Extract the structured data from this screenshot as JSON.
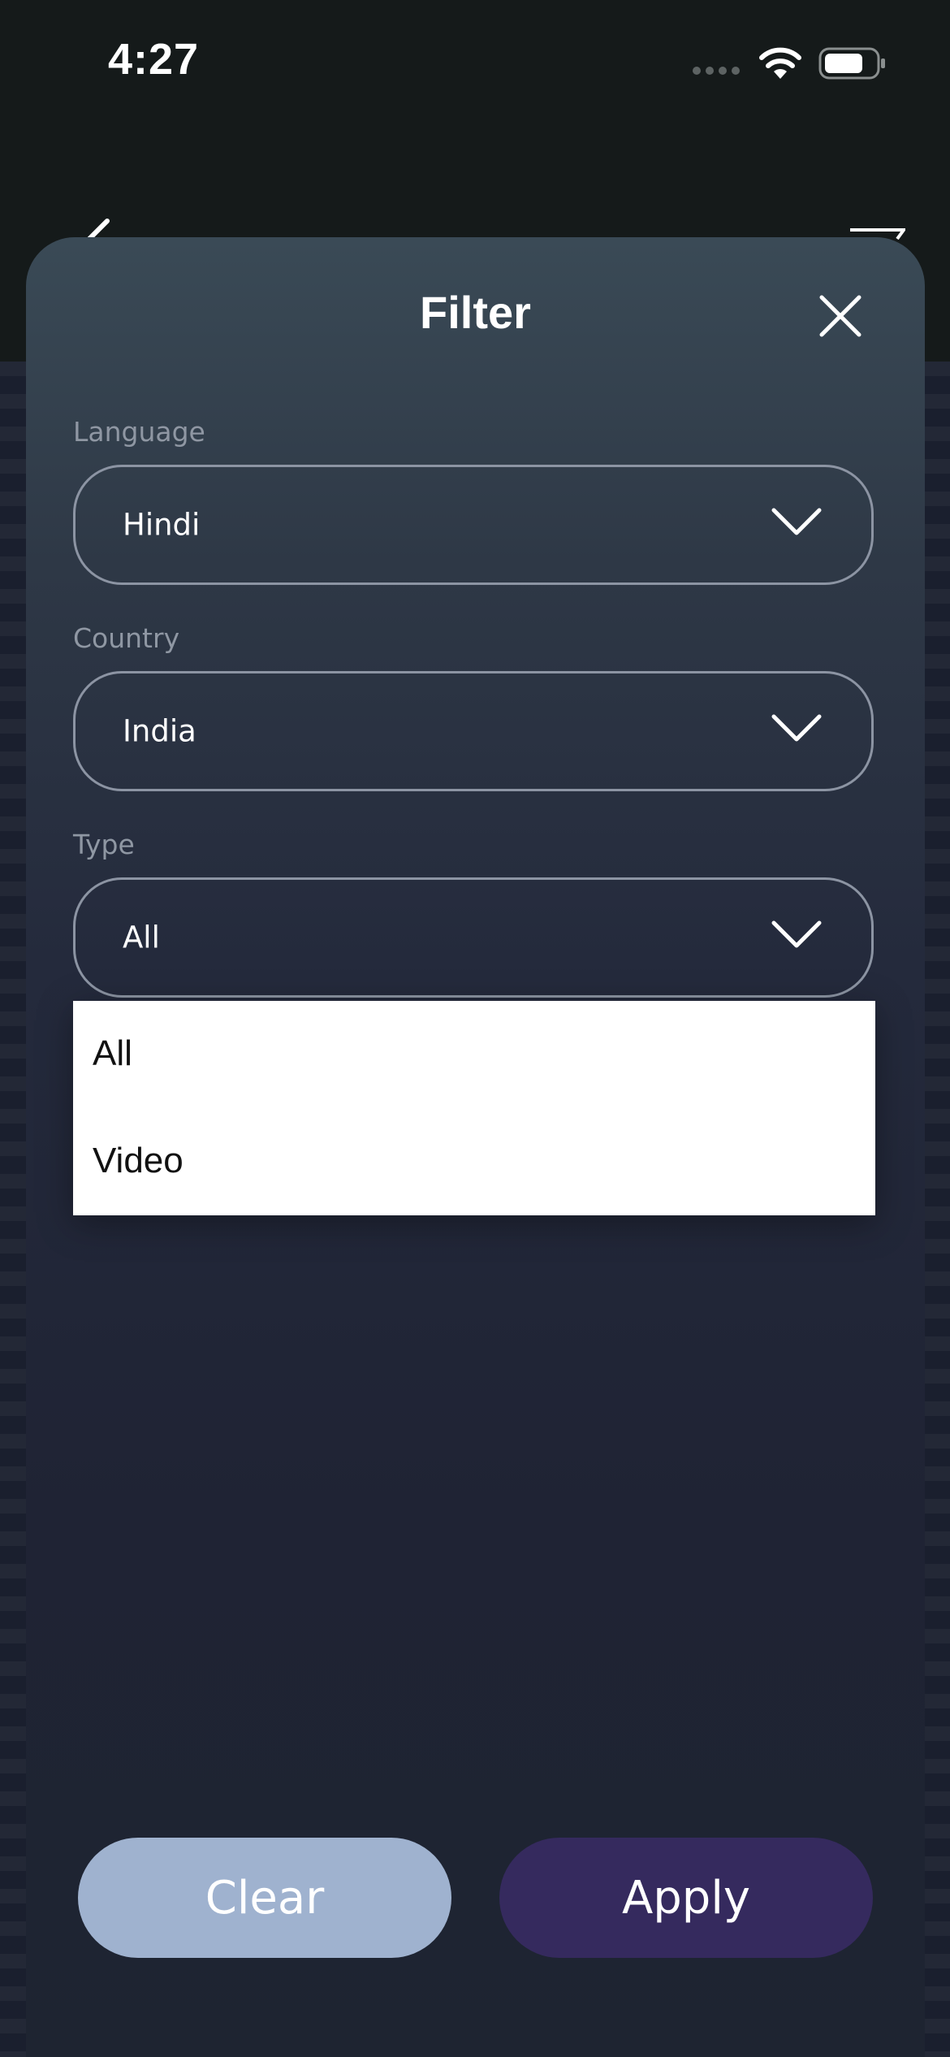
{
  "status_bar": {
    "time": "4:27"
  },
  "sheet": {
    "title": "Filter",
    "close_icon": "close-icon"
  },
  "filters": {
    "language": {
      "label": "Language",
      "value": "Hindi"
    },
    "country": {
      "label": "Country",
      "value": "India"
    },
    "type": {
      "label": "Type",
      "value": "All"
    }
  },
  "type_dropdown": {
    "options": [
      "All",
      "Video"
    ]
  },
  "buttons": {
    "clear_label": "Clear",
    "apply_label": "Apply"
  },
  "colors": {
    "clear_button": "#9fb2cf",
    "apply_button": "#352a5e",
    "sheet_top": "#3a4a56",
    "sheet_bottom": "#1e2431"
  }
}
